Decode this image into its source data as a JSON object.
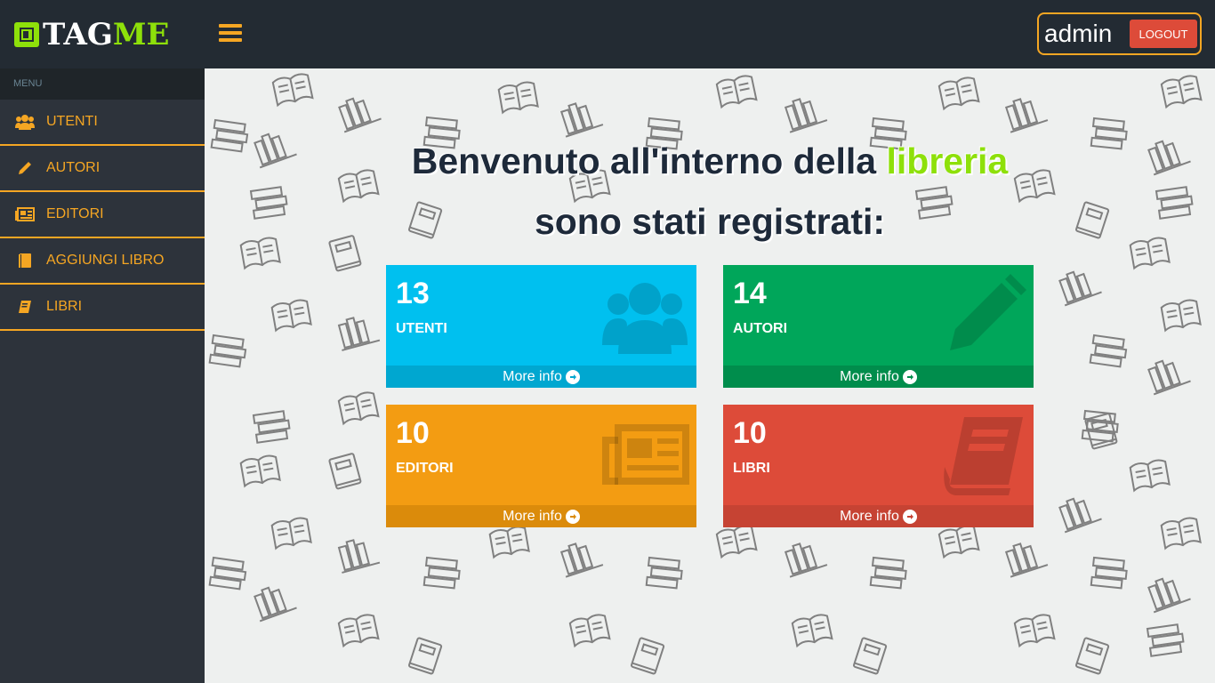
{
  "header": {
    "logo_tag": "TAG",
    "logo_me": "ME",
    "username": "admin",
    "logout_label": "LOGOUT"
  },
  "sidebar": {
    "menu_header": "MENU",
    "items": [
      {
        "label": "UTENTI",
        "icon": "users-icon"
      },
      {
        "label": "AUTORI",
        "icon": "pencil-icon"
      },
      {
        "label": "EDITORI",
        "icon": "newspaper-icon"
      },
      {
        "label": "AGGIUNGI LIBRO",
        "icon": "book-icon"
      },
      {
        "label": "LIBRI",
        "icon": "book-tilted-icon"
      }
    ]
  },
  "main": {
    "headline_line1": "Benvenuto all'interno della ",
    "headline_accent": "libreria",
    "headline_line2": "sono stati registrati:",
    "boxes": [
      {
        "count": "13",
        "label": "UTENTI",
        "more": "More info",
        "color": "#00c0ef",
        "icon": "users-icon"
      },
      {
        "count": "14",
        "label": "AUTORI",
        "more": "More info",
        "color": "#00a65a",
        "icon": "pencil-icon"
      },
      {
        "count": "10",
        "label": "EDITORI",
        "more": "More info",
        "color": "#f39c12",
        "icon": "newspaper-icon"
      },
      {
        "count": "10",
        "label": "LIBRI",
        "more": "More info",
        "color": "#dd4b39",
        "icon": "book-icon"
      }
    ]
  },
  "colors": {
    "accent_orange": "#f5a623",
    "accent_green": "#8ee00a",
    "header_bg": "#232b33",
    "sidebar_bg": "#2d333b"
  }
}
